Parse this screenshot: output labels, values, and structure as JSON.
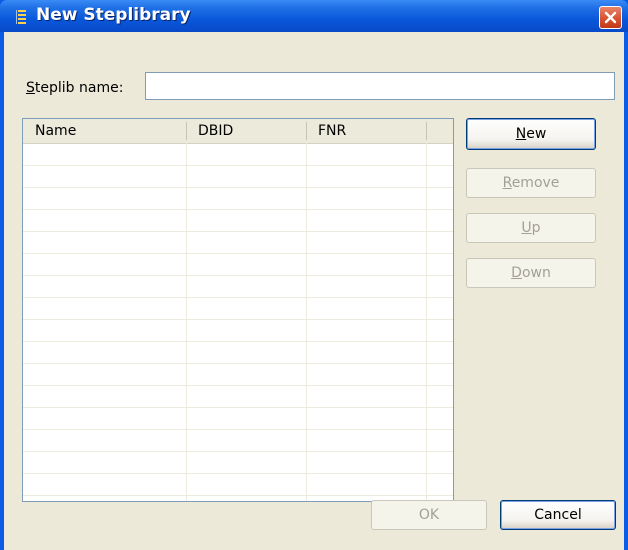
{
  "window": {
    "title": "New Steplibrary"
  },
  "form": {
    "steplib_label": "Steplib name:",
    "steplib_value": ""
  },
  "table": {
    "columns": [
      "Name",
      "DBID",
      "FNR",
      ""
    ],
    "rows": []
  },
  "side_buttons": {
    "new": {
      "mnemonic": "N",
      "rest": "ew"
    },
    "remove": {
      "mnemonic": "R",
      "rest": "emove"
    },
    "up": {
      "mnemonic": "U",
      "rest": "p"
    },
    "down": {
      "mnemonic": "D",
      "rest": "own"
    }
  },
  "footer": {
    "ok": "OK",
    "cancel": "Cancel"
  },
  "colors": {
    "title_bar": "#0a58db",
    "dialog_bg": "#ece9d8",
    "close_red": "#d8532f"
  }
}
